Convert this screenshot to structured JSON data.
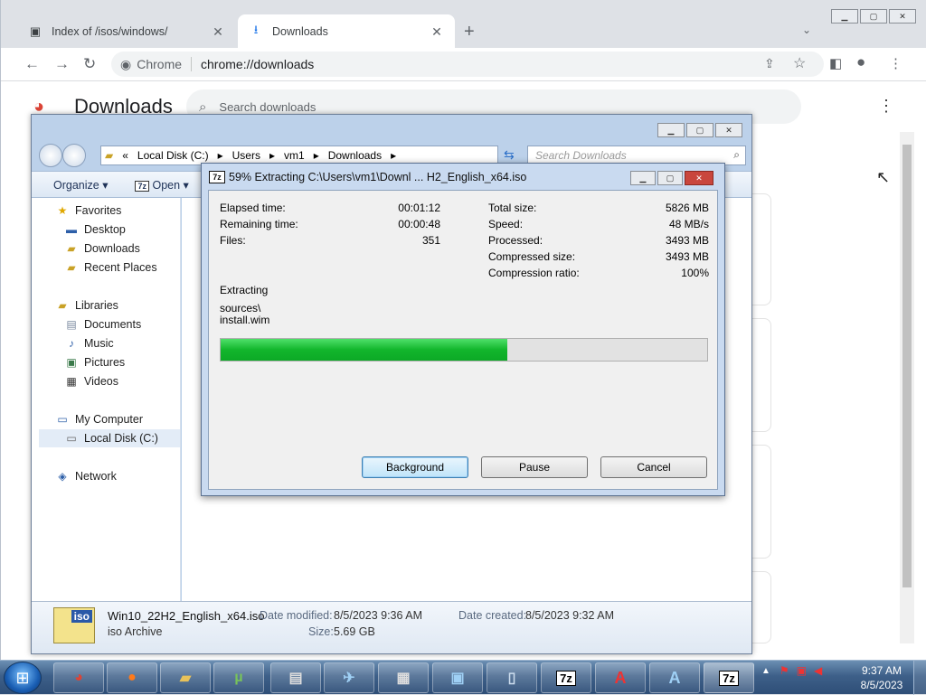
{
  "chrome": {
    "tabs": [
      {
        "title": "Index of /isos/windows/",
        "icon": "document-icon"
      },
      {
        "title": "Downloads",
        "icon": "download-icon"
      }
    ],
    "site_label": "Chrome",
    "url": "chrome://downloads",
    "page_title": "Downloads",
    "search_placeholder": "Search downloads"
  },
  "explorer": {
    "breadcrumb": [
      "Local Disk (C:)",
      "Users",
      "vm1",
      "Downloads"
    ],
    "search_placeholder": "Search Downloads",
    "toolbar": {
      "organize": "Organize",
      "open": "Open"
    },
    "nav": {
      "favorites": "Favorites",
      "desktop": "Desktop",
      "downloads": "Downloads",
      "recent": "Recent Places",
      "libraries": "Libraries",
      "documents": "Documents",
      "music": "Music",
      "pictures": "Pictures",
      "videos": "Videos",
      "my_computer": "My Computer",
      "local_disk": "Local Disk (C:)",
      "network": "Network"
    },
    "details": {
      "filename": "Win10_22H2_English_x64.iso",
      "type": "iso Archive",
      "date_modified_label": "Date modified:",
      "date_modified": "8/5/2023 9:36 AM",
      "size_label": "Size:",
      "size": "5.69 GB",
      "date_created_label": "Date created:",
      "date_created": "8/5/2023 9:32 AM",
      "icon_text": "iso"
    }
  },
  "extract_dialog": {
    "title": "59% Extracting C:\\Users\\vm1\\Downl ... H2_English_x64.iso",
    "logo": "7z",
    "left_stats": [
      {
        "label": "Elapsed time:",
        "value": "00:01:12"
      },
      {
        "label": "Remaining time:",
        "value": "00:00:48"
      },
      {
        "label": "Files:",
        "value": "351"
      }
    ],
    "right_stats": [
      {
        "label": "Total size:",
        "value": "5826 MB"
      },
      {
        "label": "Speed:",
        "value": "48 MB/s"
      },
      {
        "label": "Processed:",
        "value": "3493 MB"
      },
      {
        "label": "Compressed size:",
        "value": "3493 MB"
      },
      {
        "label": "Compression ratio:",
        "value": "100%"
      }
    ],
    "status_label": "Extracting",
    "current_path": "sources\\",
    "current_file": "install.wim",
    "progress": 0.59,
    "buttons": {
      "background": "Background",
      "pause": "Pause",
      "cancel": "Cancel"
    }
  },
  "taskbar": {
    "time": "9:37 AM",
    "date": "8/5/2023",
    "items": [
      "chrome-icon",
      "firefox-icon",
      "explorer-icon",
      "utorrent-icon",
      "printer-icon",
      "mail-icon",
      "calculator-icon",
      "remote-desktop-icon",
      "document-icon",
      "7zip-icon",
      "text-editor-icon",
      "font-icon",
      "7zip-icon"
    ],
    "seven_zip_label": "7z"
  },
  "colors": {
    "progress_green": "#12b62c",
    "chrome_tabstrip": "#dee1e6",
    "aero_frame": "#c9daf0"
  }
}
